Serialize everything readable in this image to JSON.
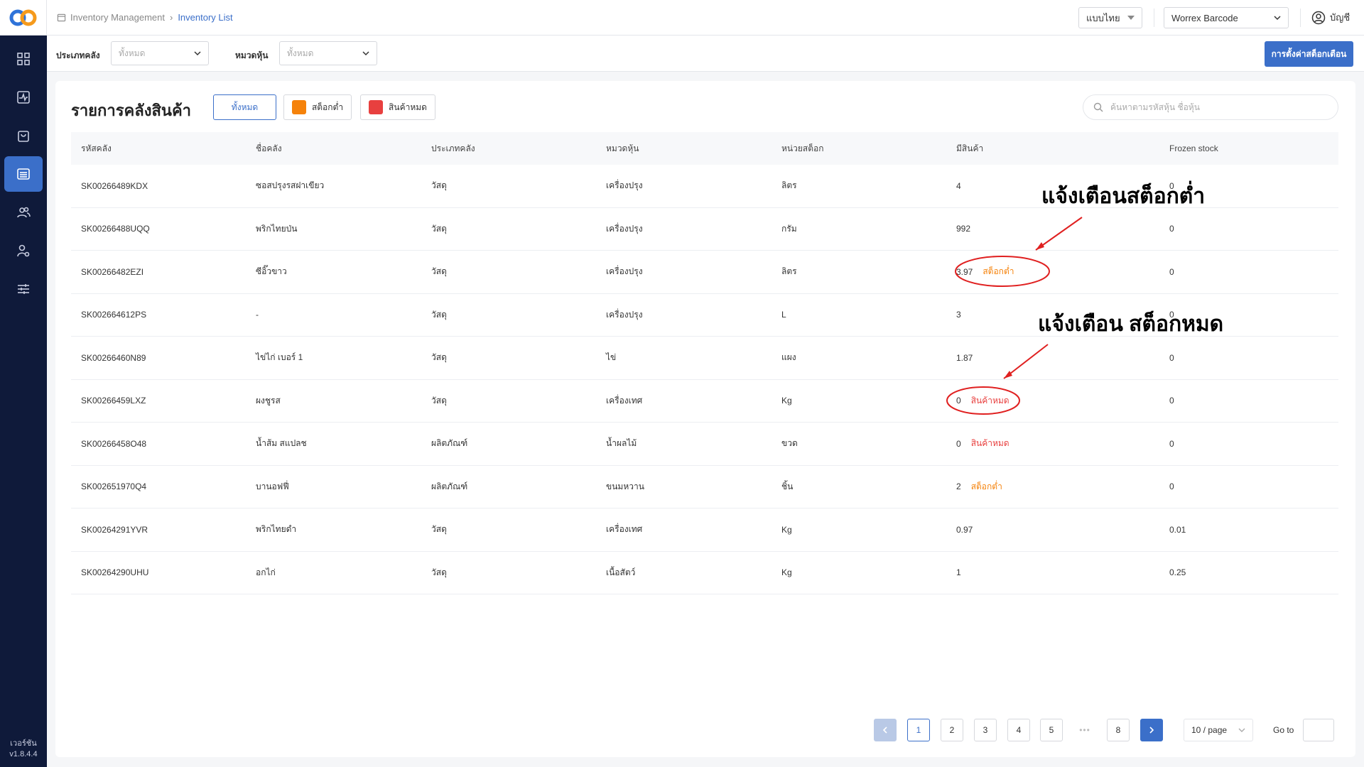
{
  "sidebar": {
    "logo": "cp-logo-icon",
    "items": [
      {
        "icon": "dashboard-grid-icon",
        "active": false
      },
      {
        "icon": "report-chart-icon",
        "active": false
      },
      {
        "icon": "shopping-bag-icon",
        "active": false
      },
      {
        "icon": "inventory-stack-icon",
        "active": true
      },
      {
        "icon": "users-group-icon",
        "active": false
      },
      {
        "icon": "user-settings-icon",
        "active": false
      },
      {
        "icon": "sliders-icon",
        "active": false
      }
    ],
    "version_label": "เวอร์ชัน",
    "version": "v1.8.4.4"
  },
  "topbar": {
    "breadcrumb": [
      "Inventory Management",
      "Inventory List"
    ],
    "language": "แบบไทย",
    "brand": "Worrex Barcode",
    "account": "บัญชี"
  },
  "filters": {
    "warehouse_type_label": "ประเภทคลัง",
    "warehouse_type_value": "ทั้งหมด",
    "category_label": "หมวดหุ้น",
    "category_value": "ทั้งหมด",
    "alert_settings_button": "การตั้งค่าสต็อกเตือน"
  },
  "card": {
    "title": "รายการคลังสินค้า",
    "filter_all": "ทั้งหมด",
    "filter_low": "สต็อกต่ำ",
    "filter_out": "สินค้าหมด",
    "low_color": "#f5820a",
    "out_color": "#e8403f",
    "search_placeholder": "ค้นหาตามรหัสหุ้น ชื่อหุ้น"
  },
  "table": {
    "headers": [
      "รหัสคลัง",
      "ชื่อคลัง",
      "ประเภทคลัง",
      "หมวดหุ้น",
      "หน่วยสต็อก",
      "มีสินค้า",
      "Frozen stock"
    ],
    "rows": [
      {
        "code": "SK00266489KDX",
        "name": "ซอสปรุงรสฝาเขียว",
        "type": "วัสดุ",
        "category": "เครื่องปรุง",
        "unit": "ลิตร",
        "qty": "4",
        "status": "",
        "frozen": "0"
      },
      {
        "code": "SK00266488UQQ",
        "name": "พริกไทยป่น",
        "type": "วัสดุ",
        "category": "เครื่องปรุง",
        "unit": "กรัม",
        "qty": "992",
        "status": "",
        "frozen": "0"
      },
      {
        "code": "SK00266482EZI",
        "name": "ซีอิ๊วขาว",
        "type": "วัสดุ",
        "category": "เครื่องปรุง",
        "unit": "ลิตร",
        "qty": "3.97",
        "status": "สต็อกต่ำ",
        "status_kind": "low",
        "frozen": "0"
      },
      {
        "code": "SK002664612PS",
        "name": "-",
        "type": "วัสดุ",
        "category": "เครื่องปรุง",
        "unit": "L",
        "qty": "3",
        "status": "",
        "frozen": "0"
      },
      {
        "code": "SK00266460N89",
        "name": "ไข่ไก่ เบอร์ 1",
        "type": "วัสดุ",
        "category": "ไข่",
        "unit": "แผง",
        "qty": "1.87",
        "status": "",
        "frozen": "0"
      },
      {
        "code": "SK00266459LXZ",
        "name": "ผงชูรส",
        "type": "วัสดุ",
        "category": "เครื่องเทศ",
        "unit": "Kg",
        "qty": "0",
        "status": "สินค้าหมด",
        "status_kind": "out",
        "frozen": "0"
      },
      {
        "code": "SK00266458O48",
        "name": "น้ำส้ม สแปลช",
        "type": "ผลิตภัณฑ์",
        "category": "น้ำผลไม้",
        "unit": "ขวด",
        "qty": "0",
        "status": "สินค้าหมด",
        "status_kind": "out",
        "frozen": "0"
      },
      {
        "code": "SK002651970Q4",
        "name": "บานอฟฟี่",
        "type": "ผลิตภัณฑ์",
        "category": "ขนมหวาน",
        "unit": "ชิ้น",
        "qty": "2",
        "status": "สต็อกต่ำ",
        "status_kind": "low",
        "frozen": "0"
      },
      {
        "code": "SK00264291YVR",
        "name": "พริกไทยดำ",
        "type": "วัสดุ",
        "category": "เครื่องเทศ",
        "unit": "Kg",
        "qty": "0.97",
        "status": "",
        "frozen": "0.01"
      },
      {
        "code": "SK00264290UHU",
        "name": "อกไก่",
        "type": "วัสดุ",
        "category": "เนื้อสัตว์",
        "unit": "Kg",
        "qty": "1",
        "status": "",
        "frozen": "0.25"
      }
    ]
  },
  "annotations": {
    "low_stock_alert": "แจ้งเตือนสต็อกต่ำ",
    "out_of_stock_alert": "แจ้งเตือน สต็อกหมด",
    "color": "#e02020"
  },
  "pagination": {
    "pages": [
      "1",
      "2",
      "3",
      "4",
      "5",
      "•••",
      "8"
    ],
    "current_page": "1",
    "per_page": "10 / page",
    "goto_label": "Go to"
  }
}
